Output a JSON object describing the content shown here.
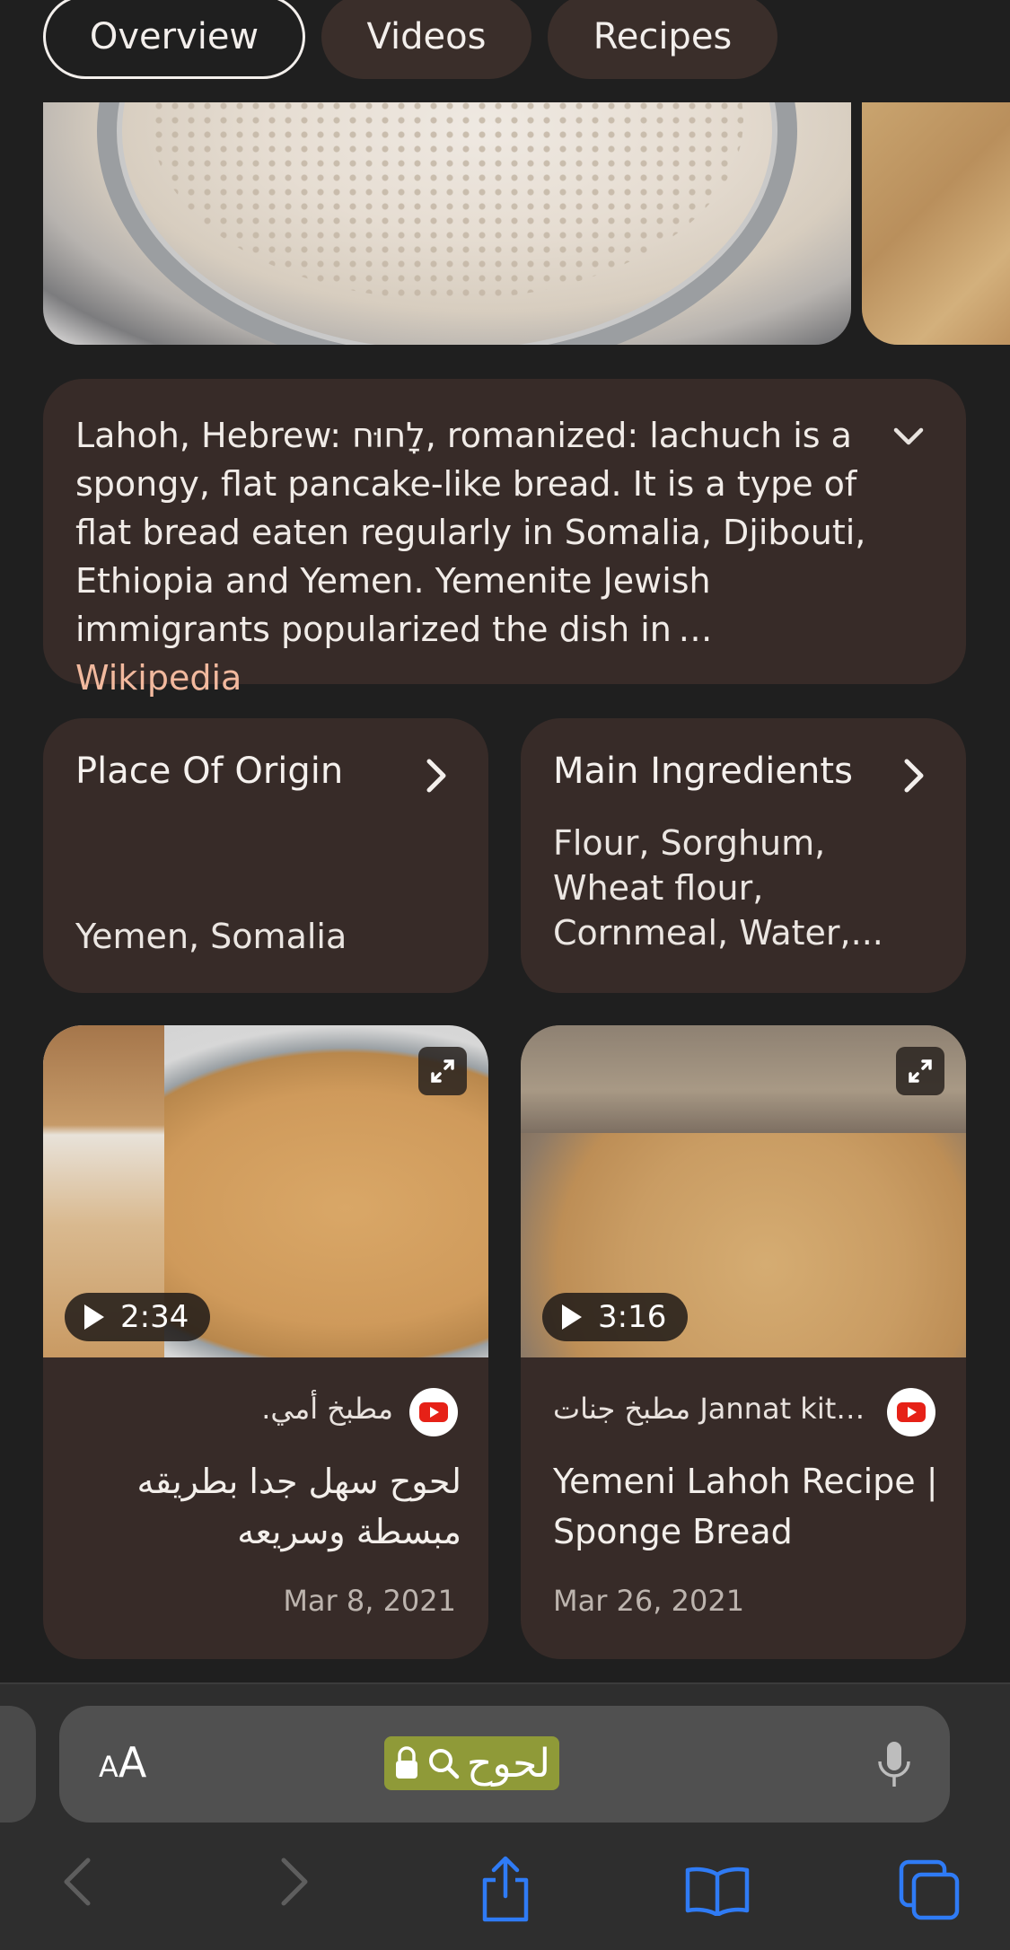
{
  "tabs": [
    "Overview",
    "Videos",
    "Recipes"
  ],
  "description": {
    "text": "Lahoh, Hebrew: לָחוּח, romanized: lachuch is a spongy, flat pancake-like bread. It is a type of flat bread eaten regularly in Somalia, Djibouti, Ethiopia and Yemen. Yemenite Jewish immigrants popularized the dish in …",
    "source": "Wikipedia"
  },
  "origin": {
    "title": "Place Of Origin",
    "value": "Yemen, Somalia"
  },
  "ingredients": {
    "title": "Main Ingredients",
    "value": "Flour, Sorghum, Wheat flour, Cornmeal, Water,..."
  },
  "videos": [
    {
      "duration": "2:34",
      "channel": "مطبخ أمي.",
      "title": "لحوح سهل جدا بطريقه مبسطة وسريعه",
      "date": "Mar 8, 2021"
    },
    {
      "duration": "3:16",
      "channel": "مطبخ جنات Jannat kit…",
      "title": "Yemeni Lahoh Recipe | Sponge Bread",
      "date": "Mar 26, 2021"
    }
  ],
  "browser": {
    "aa_small": "A",
    "aa_big": "A",
    "url": "لحوح"
  },
  "colors": {
    "accent": "#2f7bf5",
    "wiki_link": "#f2b99e",
    "card_bg": "#372b28"
  }
}
